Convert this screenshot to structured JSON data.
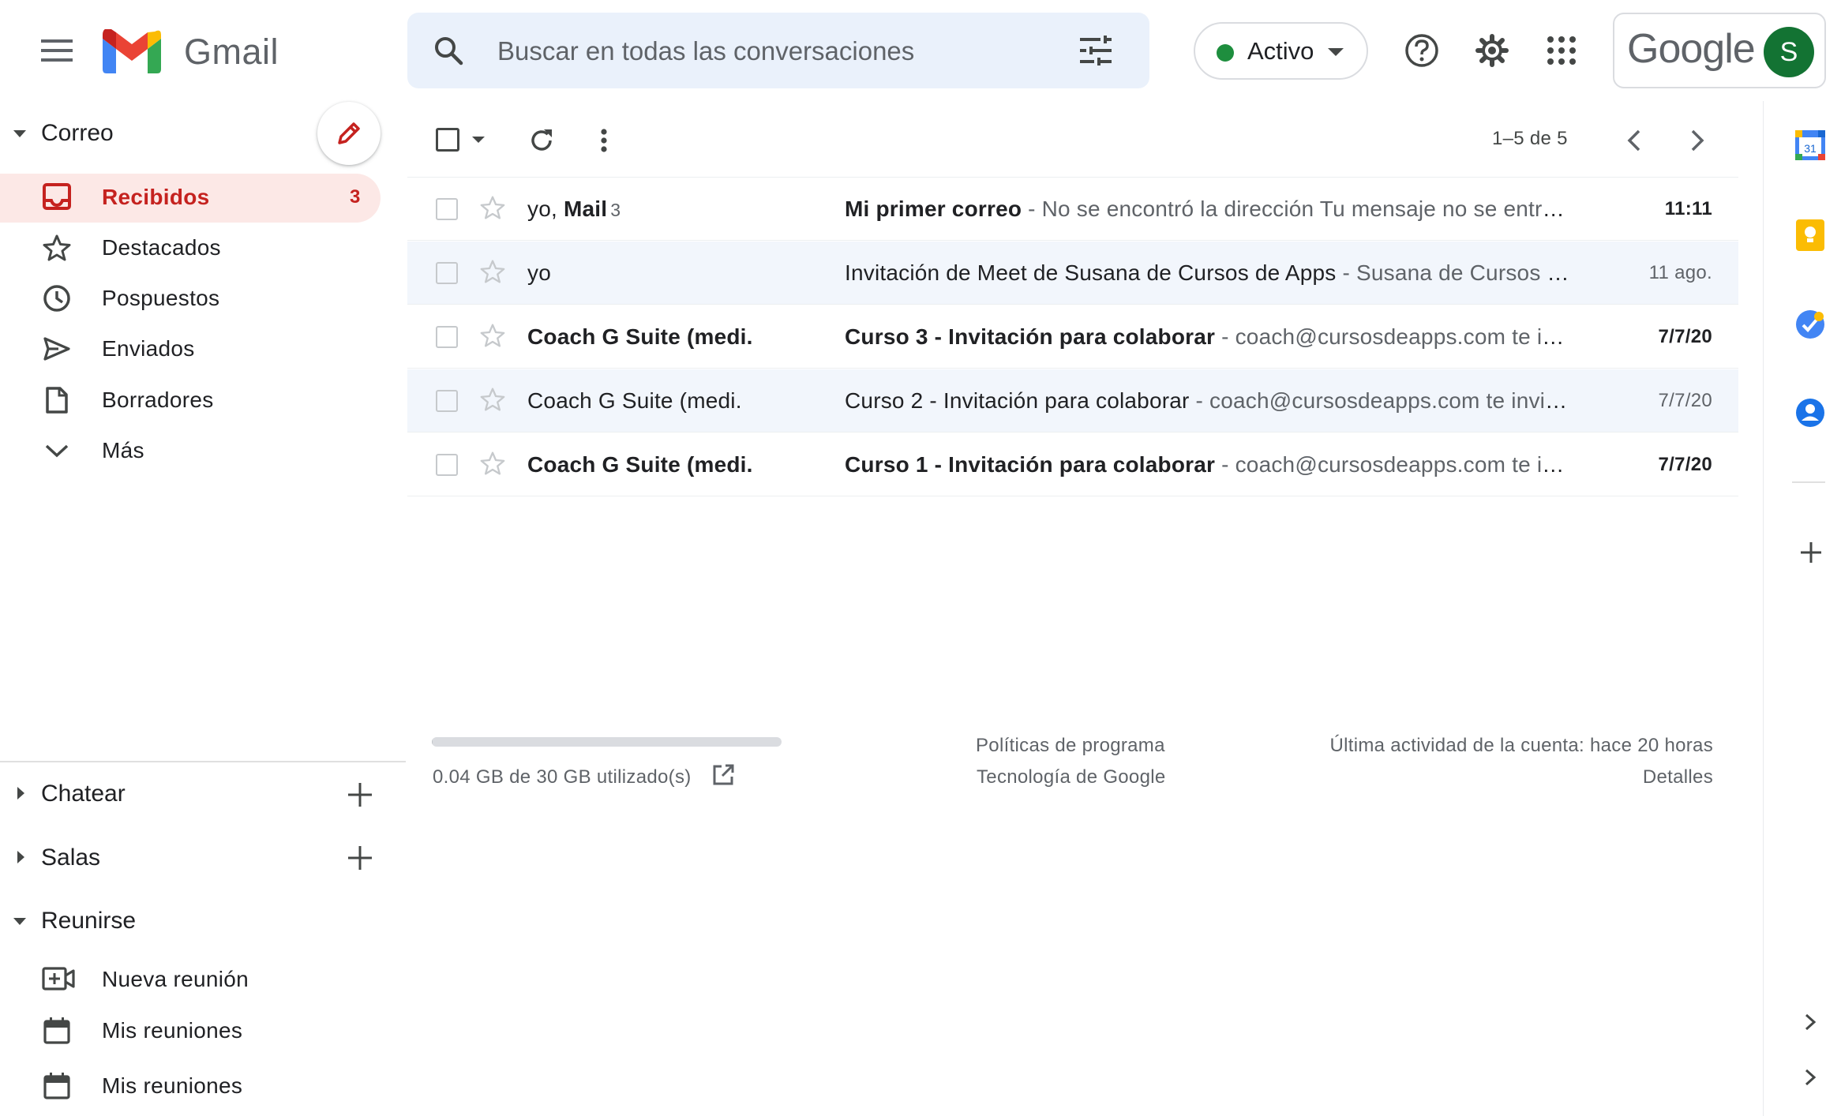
{
  "header": {
    "app_name": "Gmail",
    "search_placeholder": "Buscar en todas las conversaciones",
    "status_label": "Activo",
    "google_wordmark": "Google",
    "avatar_initial": "S"
  },
  "sidebar": {
    "mail_section": "Correo",
    "nav_items": [
      {
        "label": "Recibidos",
        "count": "3",
        "icon": "inbox-icon",
        "active": true
      },
      {
        "label": "Destacados",
        "icon": "star-icon"
      },
      {
        "label": "Pospuestos",
        "icon": "clock-icon"
      },
      {
        "label": "Enviados",
        "icon": "send-icon"
      },
      {
        "label": "Borradores",
        "icon": "draft-icon"
      },
      {
        "label": "Más",
        "icon": "chevron-down-icon"
      }
    ],
    "chat_section": "Chatear",
    "rooms_section": "Salas",
    "meet_section": "Reunirse",
    "meet_items": [
      {
        "label": "Nueva reunión",
        "icon": "video-plus-icon"
      },
      {
        "label": "Mis reuniones",
        "icon": "calendar-icon"
      },
      {
        "label": "Mis reuniones",
        "icon": "calendar-icon"
      }
    ]
  },
  "toolbar": {
    "pagination": "1–5 de 5"
  },
  "emails": [
    {
      "sender": "yo, ",
      "sender_bold": "Mail",
      "thread_count": "3",
      "subject": "Mi primer correo",
      "snippet": " - No se encontró la dirección Tu mensaje no se entregó a carl@doclsadcnso.com porque no se encontró la dirección",
      "date": "11:11",
      "unread": true
    },
    {
      "sender": "yo",
      "sender_bold": "",
      "thread_count": "",
      "subject": "Invitación de Meet de Susana de Cursos de Apps",
      "snippet": " - Susana de Cursos de Apps te invita a unirte a una reunión",
      "date": "11 ago.",
      "unread": false
    },
    {
      "sender": "",
      "sender_bold": "Coach G Suite (medi.",
      "thread_count": "",
      "subject": "Curso 3 - Invitación para colaborar",
      "snippet": " - coach@cursosdeapps.com te invita a colaborar",
      "date": "7/7/20",
      "unread": true
    },
    {
      "sender": "Coach G Suite (medi.",
      "sender_bold": "",
      "thread_count": "",
      "subject": "Curso 2 - Invitación para colaborar",
      "snippet": " - coach@cursosdeapps.com te invita a colaborar",
      "date": "7/7/20",
      "unread": false
    },
    {
      "sender": "",
      "sender_bold": "Coach G Suite (medi.",
      "thread_count": "",
      "subject": "Curso 1 - Invitación para colaborar",
      "snippet": " - coach@cursosdeapps.com te invita a colaborar",
      "date": "7/7/20",
      "unread": true
    }
  ],
  "footer": {
    "storage_text": "0.04 GB de 30 GB utilizado(s)",
    "storage_used_fraction": 0.0013,
    "policy_link": "Políticas de programa",
    "powered_by": "Tecnología de Google",
    "last_activity": "Última actividad de la cuenta: hace 20 horas",
    "details_link": "Detalles"
  },
  "right_rail": {
    "calendar_day": "31"
  },
  "colors": {
    "accent_red": "#c5221f",
    "active_bg": "#fce8e6",
    "search_bg": "#eaf1fb",
    "status_green": "#1e8e3e",
    "avatar_bg": "#137333"
  }
}
